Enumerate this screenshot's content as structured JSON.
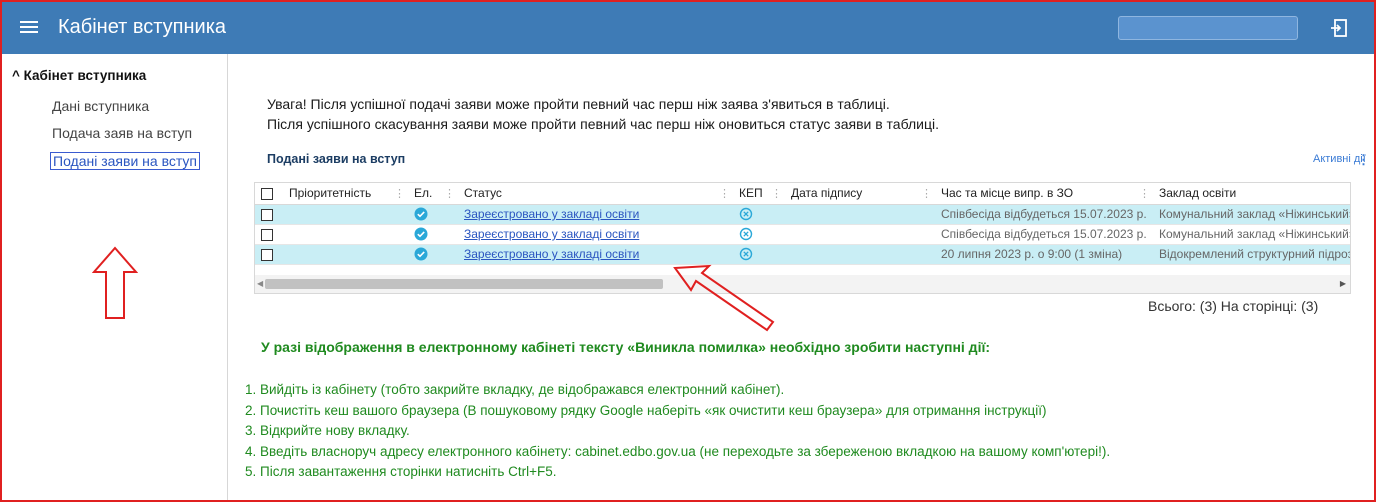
{
  "header": {
    "title": "Кабінет вступника",
    "accent": "#3e7bb6"
  },
  "sidebar": {
    "group": "^ Кабінет вступника",
    "items": [
      {
        "label": "Дані вступника"
      },
      {
        "label": "Подача заяв на вступ"
      },
      {
        "label": "Подані заяви на вступ"
      }
    ]
  },
  "notice": {
    "line1": "Увага! Після успішної подачі заяви може пройти певний час перш ніж заява з'явиться в таблиці.",
    "line2": "Після успішного скасування заяви може пройти певний час перш ніж оновиться статус заяви в таблиці."
  },
  "grid": {
    "title": "Подані заяви на вступ",
    "active_actions": "Активні дії",
    "columns": [
      "Пріоритетність",
      "Ел.",
      "Статус",
      "КЕП",
      "Дата підпису",
      "Час та місце випр. в ЗО",
      "Заклад освіти"
    ],
    "rows": [
      {
        "priority": "",
        "status": "Зареєстровано у закладі освіти",
        "sign_date": "",
        "exam": "Співбесіда відбудеться 15.07.2023 р.",
        "school": "Комунальний заклад «Ніжинський»"
      },
      {
        "priority": "",
        "status": "Зареєстровано у закладі освіти",
        "sign_date": "",
        "exam": "Співбесіда відбудеться 15.07.2023 р.",
        "school": "Комунальний заклад «Ніжинський»"
      },
      {
        "priority": "",
        "status": "Зареєстровано у закладі освіти",
        "sign_date": "",
        "exam": "20 липня 2023 р. о 9:00 (1 зміна)",
        "school": "Відокремлений структурний підрозділ"
      }
    ],
    "total": "Всього: (3) На сторінці: (3)"
  },
  "warning": {
    "title": "У разі відображення в електронному кабінеті тексту «Виникла помилка» необхідно зробити наступні дії:",
    "steps": [
      "1. Вийдіть із кабінету (тобто закрийте вкладку, де відображався електронний кабінет).",
      "2. Почистіть кеш вашого браузера (В пошуковому рядку Google наберіть «як очистити кеш браузера» для отримання інструкції)",
      "3. Відкрийте нову вкладку.",
      "4. Введіть власноруч адресу електронного кабінету: cabinet.edbo.gov.ua (не переходьте за збереженою вкладкою на вашому комп'ютері!).",
      "5. Після завантаження сторінки натисніть Ctrl+F5."
    ]
  }
}
